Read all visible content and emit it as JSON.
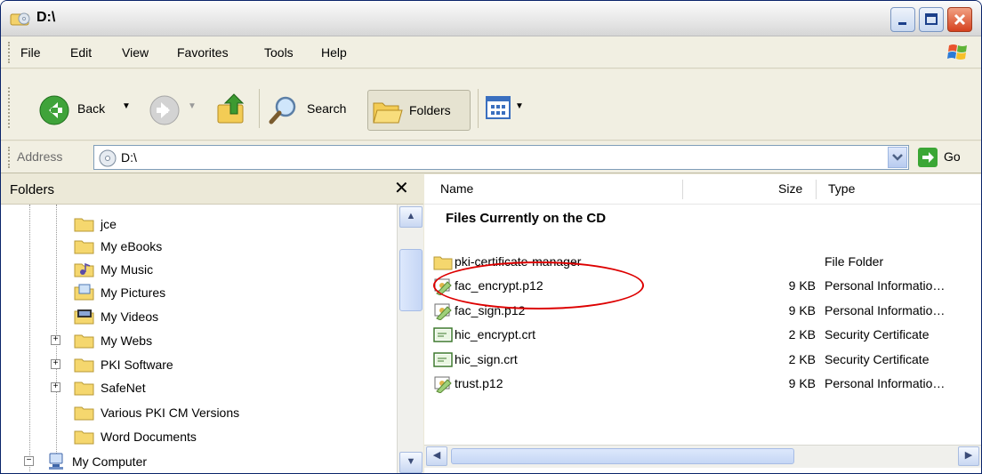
{
  "window": {
    "title": "D:\\"
  },
  "menu": [
    "File",
    "Edit",
    "View",
    "Favorites",
    "Tools",
    "Help"
  ],
  "toolbar": {
    "back_label": "Back",
    "search_label": "Search",
    "folders_label": "Folders"
  },
  "address": {
    "label": "Address",
    "value": "D:\\",
    "go_label": "Go"
  },
  "folders_pane": {
    "title": "Folders",
    "close_glyph": "✕",
    "items": [
      {
        "label": "jce",
        "expander": false
      },
      {
        "label": "My eBooks",
        "expander": false
      },
      {
        "label": "My Music",
        "expander": false
      },
      {
        "label": "My Pictures",
        "expander": false
      },
      {
        "label": "My Videos",
        "expander": false
      },
      {
        "label": "My Webs",
        "expander": true
      },
      {
        "label": "PKI Software",
        "expander": true
      },
      {
        "label": "SafeNet",
        "expander": true
      },
      {
        "label": "Various PKI CM Versions",
        "expander": false
      },
      {
        "label": "Word Documents",
        "expander": false
      },
      {
        "label": "My Computer",
        "expander": true
      }
    ]
  },
  "files_pane": {
    "columns": {
      "name": "Name",
      "size": "Size",
      "type": "Type"
    },
    "group_title": "Files Currently on the CD",
    "rows": [
      {
        "name": "pki-certificate-manager",
        "size": "",
        "type": "File Folder",
        "icon": "folder-icon"
      },
      {
        "name": "fac_encrypt.p12",
        "size": "9 KB",
        "type": "Personal Informatio…",
        "icon": "certificate-p12-icon"
      },
      {
        "name": "fac_sign.p12",
        "size": "9 KB",
        "type": "Personal Informatio…",
        "icon": "certificate-p12-icon"
      },
      {
        "name": "hic_encrypt.crt",
        "size": "2 KB",
        "type": "Security Certificate",
        "icon": "certificate-crt-icon"
      },
      {
        "name": "hic_sign.crt",
        "size": "2 KB",
        "type": "Security Certificate",
        "icon": "certificate-crt-icon"
      },
      {
        "name": "trust.p12",
        "size": "9 KB",
        "type": "Personal Informatio…",
        "icon": "certificate-p12-icon"
      }
    ]
  },
  "colors": {
    "highlight": "#dd0000",
    "folder": "#f5d76e",
    "go_arrow": "#2f9e2f"
  }
}
